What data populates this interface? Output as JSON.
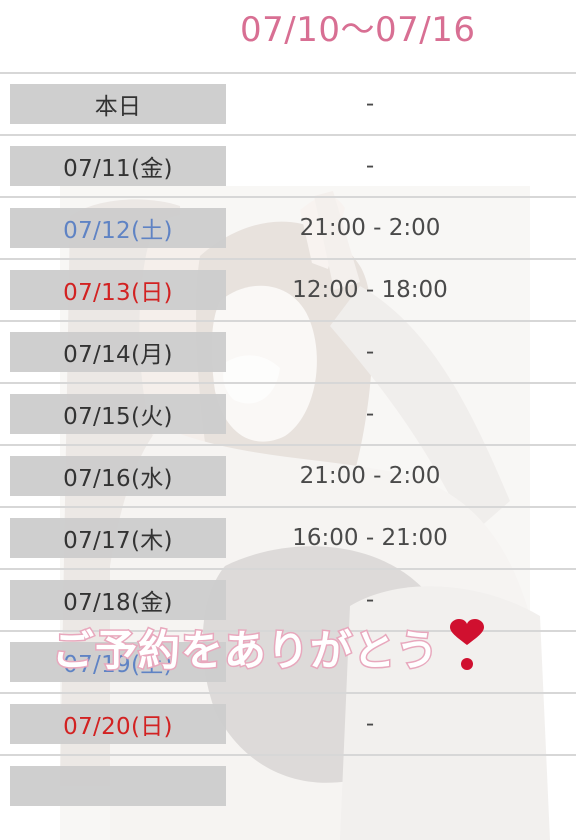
{
  "header": {
    "week_range": "07/10〜07/16"
  },
  "rows": [
    {
      "date": "本日",
      "day_type": "weekday",
      "time": "-"
    },
    {
      "date": "07/11(金)",
      "day_type": "weekday",
      "time": "-"
    },
    {
      "date": "07/12(土)",
      "day_type": "saturday",
      "time": "21:00 - 2:00"
    },
    {
      "date": "07/13(日)",
      "day_type": "sunday",
      "time": "12:00 - 18:00"
    },
    {
      "date": "07/14(月)",
      "day_type": "weekday",
      "time": "-"
    },
    {
      "date": "07/15(火)",
      "day_type": "weekday",
      "time": "-"
    },
    {
      "date": "07/16(水)",
      "day_type": "weekday",
      "time": "21:00 - 2:00"
    },
    {
      "date": "07/17(木)",
      "day_type": "weekday",
      "time": "16:00 - 21:00"
    },
    {
      "date": "07/18(金)",
      "day_type": "weekday",
      "time": "-"
    },
    {
      "date": "07/19(土)",
      "day_type": "saturday",
      "time": ""
    },
    {
      "date": "07/20(日)",
      "day_type": "sunday",
      "time": "-"
    },
    {
      "date": "",
      "day_type": "weekday",
      "time": ""
    }
  ],
  "overlay": {
    "message": "ご予約をありがとう",
    "icon": "heavy-exclamation-heart-icon"
  },
  "colors": {
    "title_pink": "#d86f93",
    "saturday_blue": "#5f83c4",
    "sunday_red": "#d22222",
    "date_cell_gray": "#cdcdcd",
    "heart_red": "#d0102f"
  }
}
